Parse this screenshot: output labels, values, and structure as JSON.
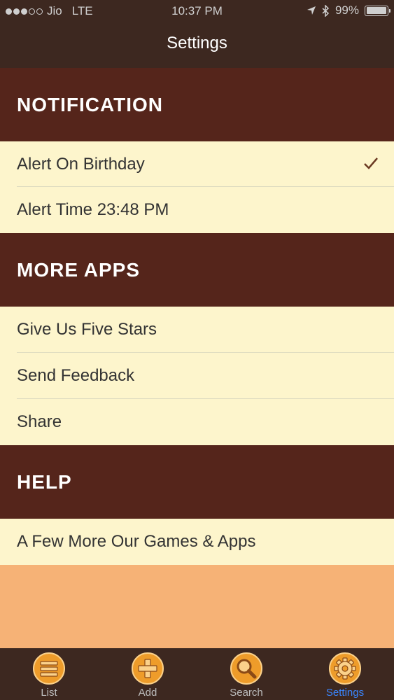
{
  "status_bar": {
    "carrier": "Jio",
    "network": "LTE",
    "time": "10:37 PM",
    "battery_percent": "99%",
    "battery_level": 0.99,
    "signal_bars_filled": 3,
    "signal_bars_total": 5
  },
  "nav": {
    "title": "Settings"
  },
  "sections": {
    "notification": {
      "header": "NOTIFICATION",
      "rows": [
        {
          "label": "Alert On Birthday",
          "checked": true
        },
        {
          "label": "Alert Time 23:48 PM"
        }
      ]
    },
    "more_apps": {
      "header": "MORE APPS",
      "rows": [
        {
          "label": "Give Us Five Stars"
        },
        {
          "label": "Send Feedback"
        },
        {
          "label": "Share"
        }
      ]
    },
    "help": {
      "header": "HELP",
      "rows": [
        {
          "label": "A Few More Our Games & Apps"
        }
      ]
    }
  },
  "tab_bar": {
    "tabs": [
      {
        "label": "List",
        "icon": "list-icon"
      },
      {
        "label": "Add",
        "icon": "plus-icon"
      },
      {
        "label": "Search",
        "icon": "search-icon"
      },
      {
        "label": "Settings",
        "icon": "gear-icon",
        "active": true
      }
    ]
  },
  "colors": {
    "bar_background": "#3d2820",
    "section_header": "#55251b",
    "row_background": "#fdf5cc",
    "page_background": "#f6b276",
    "tab_icon": "#ee9c2a",
    "active_tab_label": "#3a86ff"
  }
}
